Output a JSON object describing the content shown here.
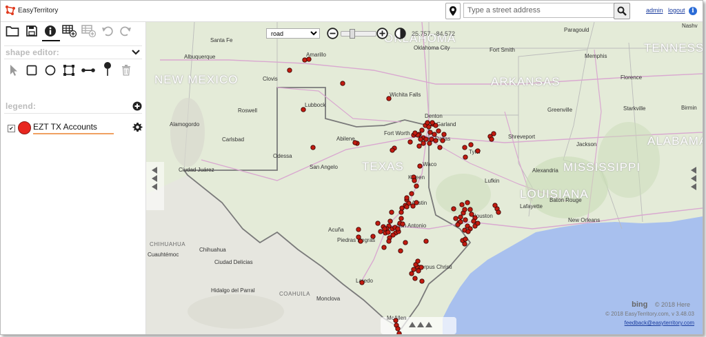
{
  "app": {
    "logo_text": "EasyTerritory"
  },
  "header": {
    "address_placeholder": "Type a street address",
    "user_link": "admin",
    "logout_link": "logout"
  },
  "sidebar": {
    "shape_editor_title": "shape editor:",
    "legend_title": "legend:",
    "legend_items": [
      {
        "label": "EZT TX Accounts",
        "checked": true,
        "color": "#e8261f"
      }
    ]
  },
  "map": {
    "style_selected": "road",
    "style_options": [
      "road"
    ],
    "coords": "25.757, -84.572",
    "attribution": "© 2018 Here",
    "bing_label": "bing",
    "version": "© 2018 EasyTerritory.com, v 3.48.03",
    "feedback": "feedback@easyterritory.com",
    "accent_water": "#a8c0ee",
    "marker_color": "#c21b10",
    "labels": {
      "states": [
        "NEW MEXICO",
        "OKLAHOMA",
        "ARKANSAS",
        "TEXAS",
        "MISSISSIPPI",
        "LOUISIANA",
        "TENNESSEE",
        "ALABAMA"
      ],
      "small_states": [
        "CHIHUAHUA",
        "COAHUILA"
      ],
      "cities": [
        "Santa Fe",
        "Albuquerque",
        "Amarillo",
        "Oklahoma City",
        "Fort Smith",
        "Memphis",
        "Paragould",
        "Nashv",
        "Clovis",
        "Lubbock",
        "Wichita Falls",
        "Roswell",
        "Alamogordo",
        "Carlsbad",
        "Denton",
        "Garland",
        "Fort Worth",
        "Dallas",
        "Abilene",
        "Odessa",
        "Shreveport",
        "Jackson",
        "Greenville",
        "Florence",
        "Starkville",
        "Birmin",
        "Tyler",
        "San Angelo",
        "Waco",
        "Killeen",
        "Lufkin",
        "Ciudad Juárez",
        "Austin",
        "Houston",
        "San Antonio",
        "Acuña",
        "Piedras Negras",
        "Chihuahua",
        "Cuauhtémoc",
        "Ciudad Delicias",
        "Corpus Christi",
        "Laredo",
        "Hidalgo del Parral",
        "Monclova",
        "McAllen",
        "New Orleans",
        "Baton Rouge",
        "Lafayette",
        "Alexandria"
      ]
    }
  }
}
